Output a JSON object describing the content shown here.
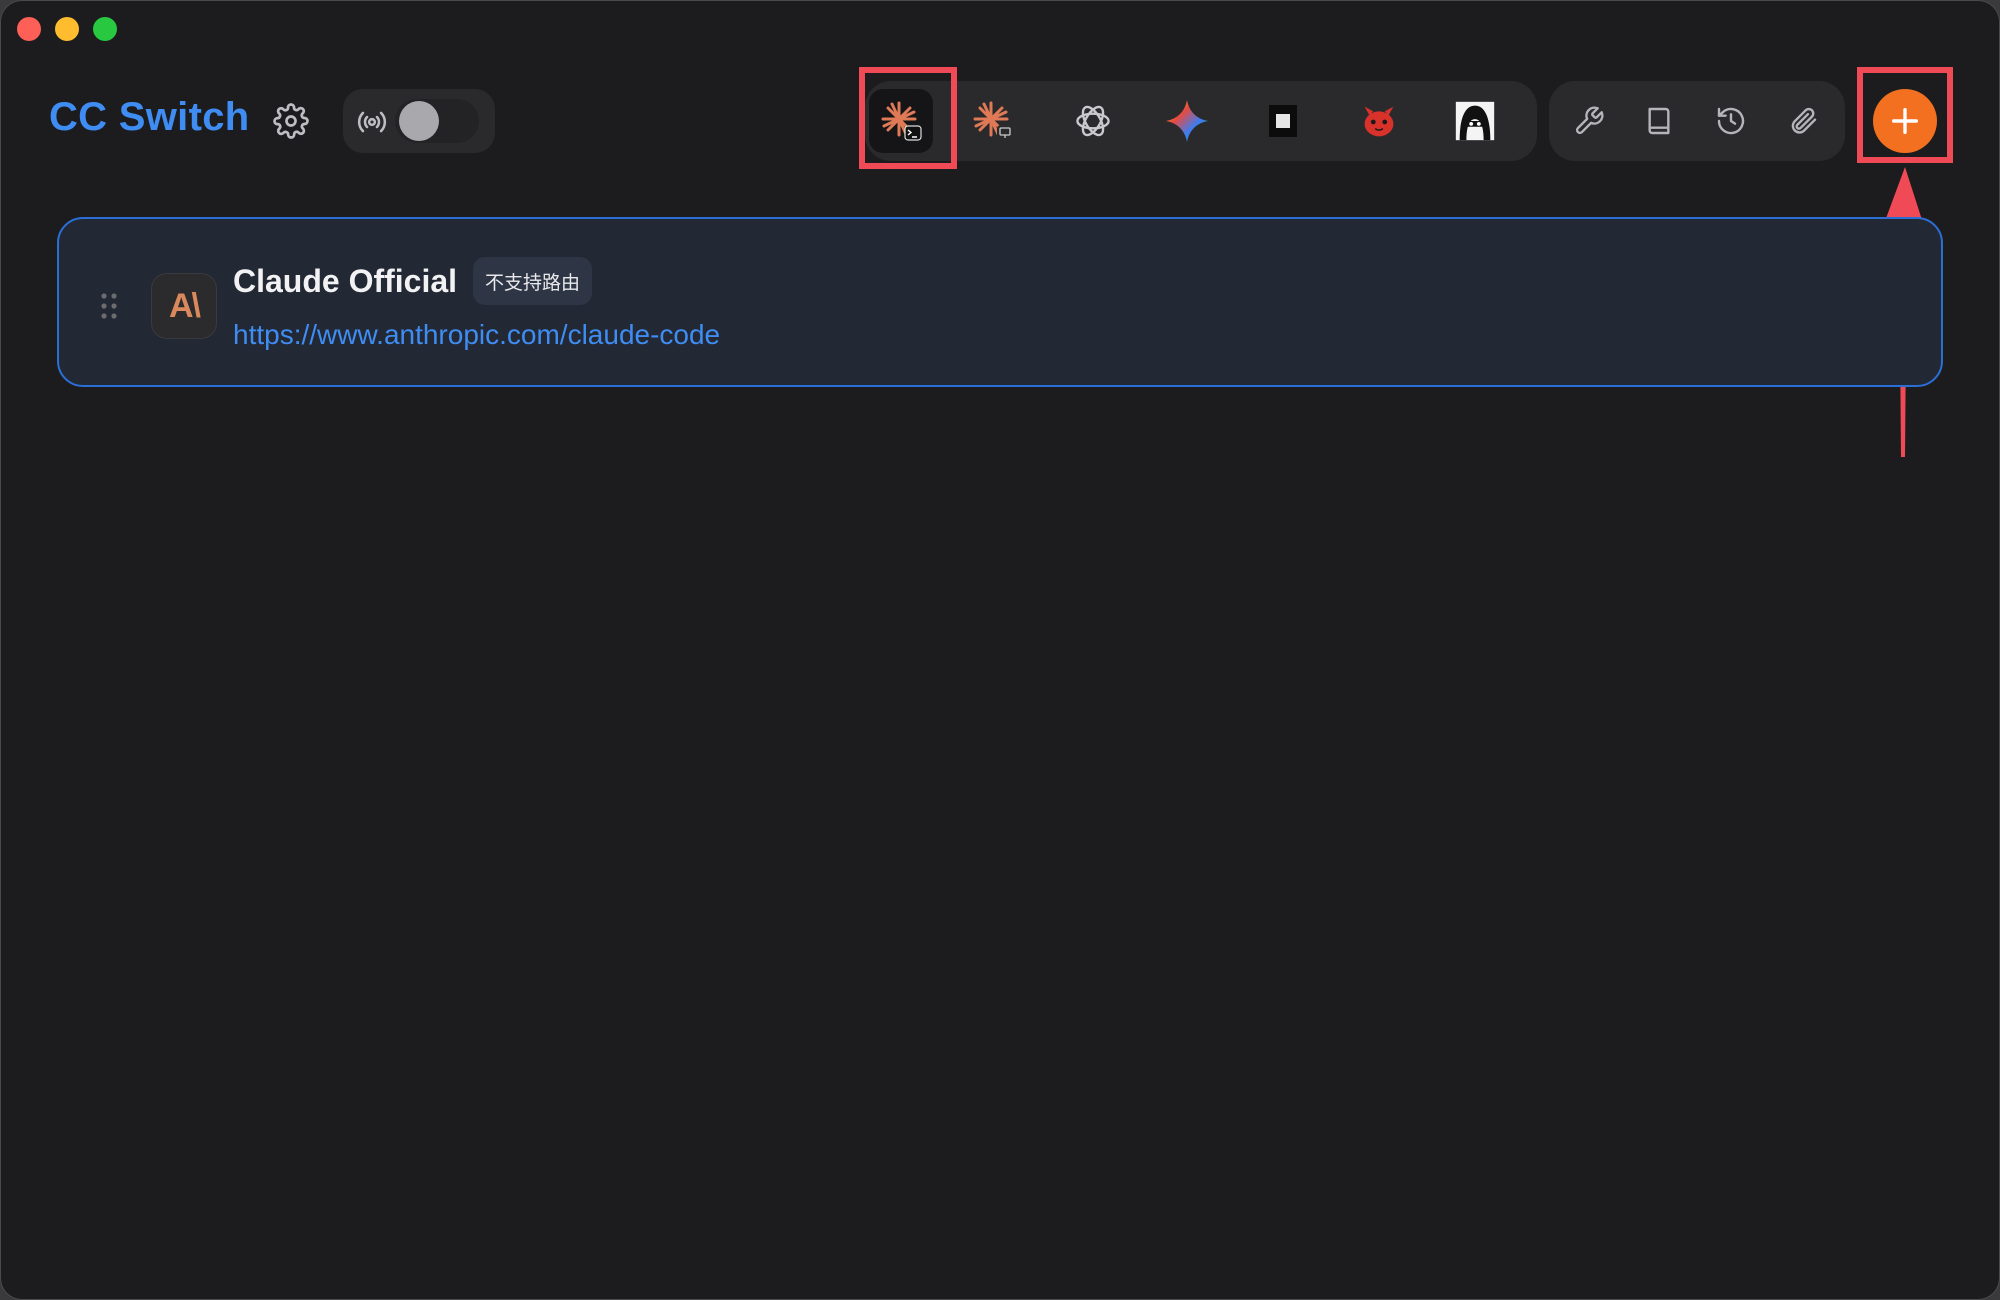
{
  "app": {
    "title": "CC Switch"
  },
  "provider": {
    "name": "Claude Official",
    "badge": "不支持路由",
    "url": "https://www.anthropic.com/claude-code",
    "logo_text": "A\\"
  },
  "apps": [
    {
      "name": "claude-code-icon",
      "active": true
    },
    {
      "name": "claude-desktop-icon",
      "active": false
    },
    {
      "name": "openai-icon",
      "active": false
    },
    {
      "name": "gemini-icon",
      "active": false
    },
    {
      "name": "square-app-icon",
      "active": false
    },
    {
      "name": "red-mascot-icon",
      "active": false
    },
    {
      "name": "avatar-app-icon",
      "active": false
    }
  ],
  "tools": [
    "wrench-icon",
    "book-icon",
    "history-icon",
    "paperclip-icon"
  ],
  "colors": {
    "accent": "#3f8cf2",
    "add_button": "#f37021",
    "highlight": "#ef4a55",
    "background": "#1c1c1e"
  },
  "proxy": {
    "enabled": false
  }
}
